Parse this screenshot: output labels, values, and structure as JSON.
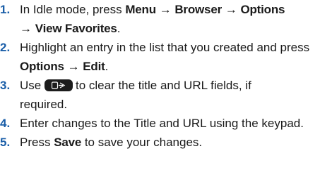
{
  "steps": [
    {
      "number": "1.",
      "lines": [
        {
          "t1": "In Idle mode, press ",
          "b1": "Menu",
          "a1": " → ",
          "b2": "Browser",
          "a2": " → ",
          "b3": "Options"
        },
        {
          "a3": "→ ",
          "b4": "View Favorites",
          "t2": "."
        }
      ]
    },
    {
      "number": "2.",
      "line1": "Highlight an entry in the list that you created and press",
      "b1": "Options",
      "a1": " → ",
      "b2": "Edit",
      "t2": "."
    },
    {
      "number": "3.",
      "t1": "Use",
      "icon": "clear-key-icon",
      "t2": "to clear the title and URL fields, if",
      "line2": "required."
    },
    {
      "number": "4.",
      "text": "Enter changes to the Title and URL using the keypad."
    },
    {
      "number": "5.",
      "t1": "Press ",
      "b1": "Save",
      "t2": " to save your changes."
    }
  ]
}
